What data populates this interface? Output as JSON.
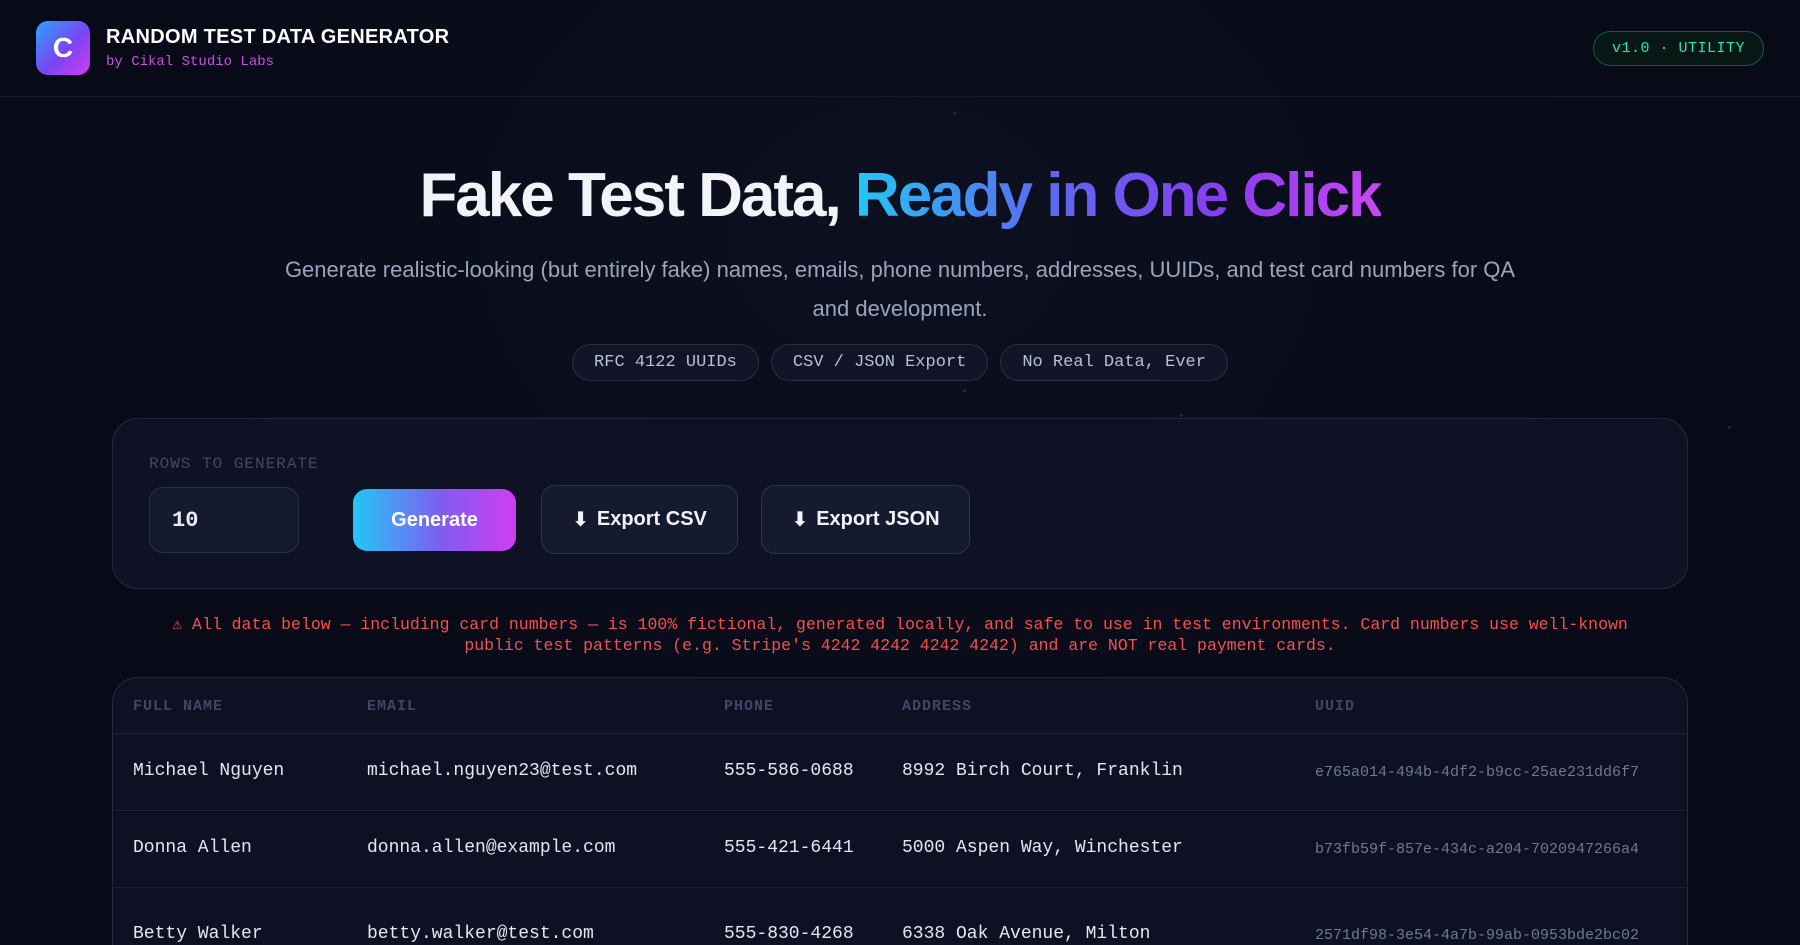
{
  "header": {
    "logo_letter": "C",
    "title": "RANDOM TEST DATA GENERATOR",
    "subtitle": "by Cikal Studio Labs",
    "version": "v1.0 · UTILITY"
  },
  "hero": {
    "title_plain": "Fake Test Data, ",
    "title_highlight": "Ready in One Click",
    "description": "Generate realistic-looking (but entirely fake) names, emails, phone numbers, addresses, UUIDs, and test card numbers for QA and development.",
    "chips": [
      "RFC 4122 UUIDs",
      "CSV / JSON Export",
      "No Real Data, Ever"
    ]
  },
  "controls": {
    "rows_label": "ROWS TO GENERATE",
    "rows_value": "10",
    "generate_label": "Generate",
    "export_csv_label": "Export CSV",
    "export_json_label": "Export JSON",
    "download_icon": "⬇"
  },
  "warning": "⚠ All data below — including card numbers — is 100% fictional, generated locally, and safe to use in test environments. Card numbers use well-known public test patterns (e.g. Stripe's 4242 4242 4242 4242) and are NOT real payment cards.",
  "table": {
    "columns": [
      "FULL NAME",
      "EMAIL",
      "PHONE",
      "ADDRESS",
      "UUID"
    ],
    "rows": [
      [
        "Michael Nguyen",
        "michael.nguyen23@test.com",
        "555-586-0688",
        "8992 Birch Court, Franklin",
        "e765a014-494b-4df2-b9cc-25ae231dd6f7"
      ],
      [
        "Donna Allen",
        "donna.allen@example.com",
        "555-421-6441",
        "5000 Aspen Way, Winchester",
        "b73fb59f-857e-434c-a204-7020947266a4"
      ],
      [
        "Betty Walker",
        "betty.walker@test.com",
        "555-830-4268",
        "6338 Oak Avenue, Milton",
        "2571df98-3e54-4a7b-99ab-0953bde2bc02"
      ]
    ]
  }
}
